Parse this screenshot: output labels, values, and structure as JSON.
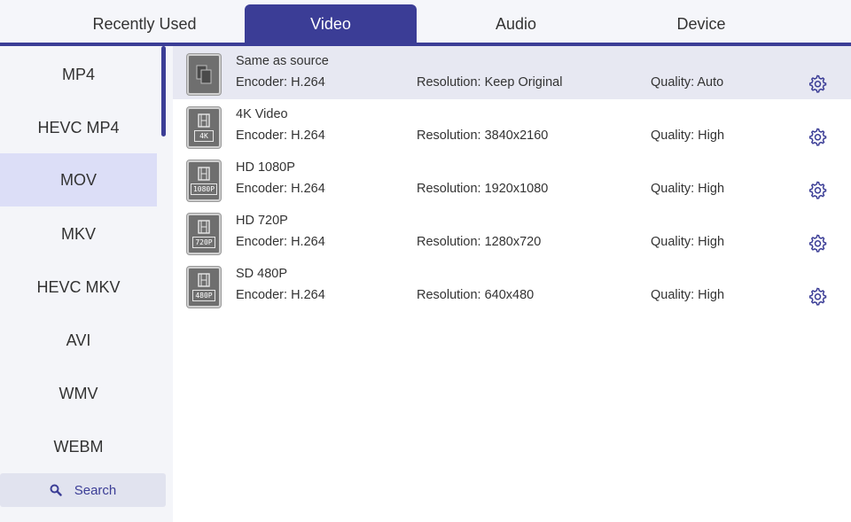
{
  "tabs": [
    {
      "label": "Recently Used"
    },
    {
      "label": "Video"
    },
    {
      "label": "Audio"
    },
    {
      "label": "Device"
    }
  ],
  "active_tab": "Video",
  "sidebar": {
    "items": [
      {
        "label": "MP4"
      },
      {
        "label": "HEVC MP4"
      },
      {
        "label": "MOV"
      },
      {
        "label": "MKV"
      },
      {
        "label": "HEVC MKV"
      },
      {
        "label": "AVI"
      },
      {
        "label": "WMV"
      },
      {
        "label": "WEBM"
      }
    ],
    "selected": "MOV",
    "search_label": "Search"
  },
  "presets": [
    {
      "name": "Same as source",
      "encoder": "Encoder: H.264",
      "resolution": "Resolution: Keep Original",
      "quality": "Quality: Auto",
      "badge": ""
    },
    {
      "name": "4K Video",
      "encoder": "Encoder: H.264",
      "resolution": "Resolution: 3840x2160",
      "quality": "Quality: High",
      "badge": "4K"
    },
    {
      "name": "HD 1080P",
      "encoder": "Encoder: H.264",
      "resolution": "Resolution: 1920x1080",
      "quality": "Quality: High",
      "badge": "1080P"
    },
    {
      "name": "HD 720P",
      "encoder": "Encoder: H.264",
      "resolution": "Resolution: 1280x720",
      "quality": "Quality: High",
      "badge": "720P"
    },
    {
      "name": "SD 480P",
      "encoder": "Encoder: H.264",
      "resolution": "Resolution: 640x480",
      "quality": "Quality: High",
      "badge": "480P"
    }
  ],
  "icons": {
    "thumb": "film-icon",
    "source": "copy-icon",
    "settings": "gear-icon",
    "search": "search-icon"
  },
  "colors": {
    "accent": "#3b3d96",
    "selected_sidebar": "#dcdef7",
    "selected_row": "#e7e8f2"
  }
}
